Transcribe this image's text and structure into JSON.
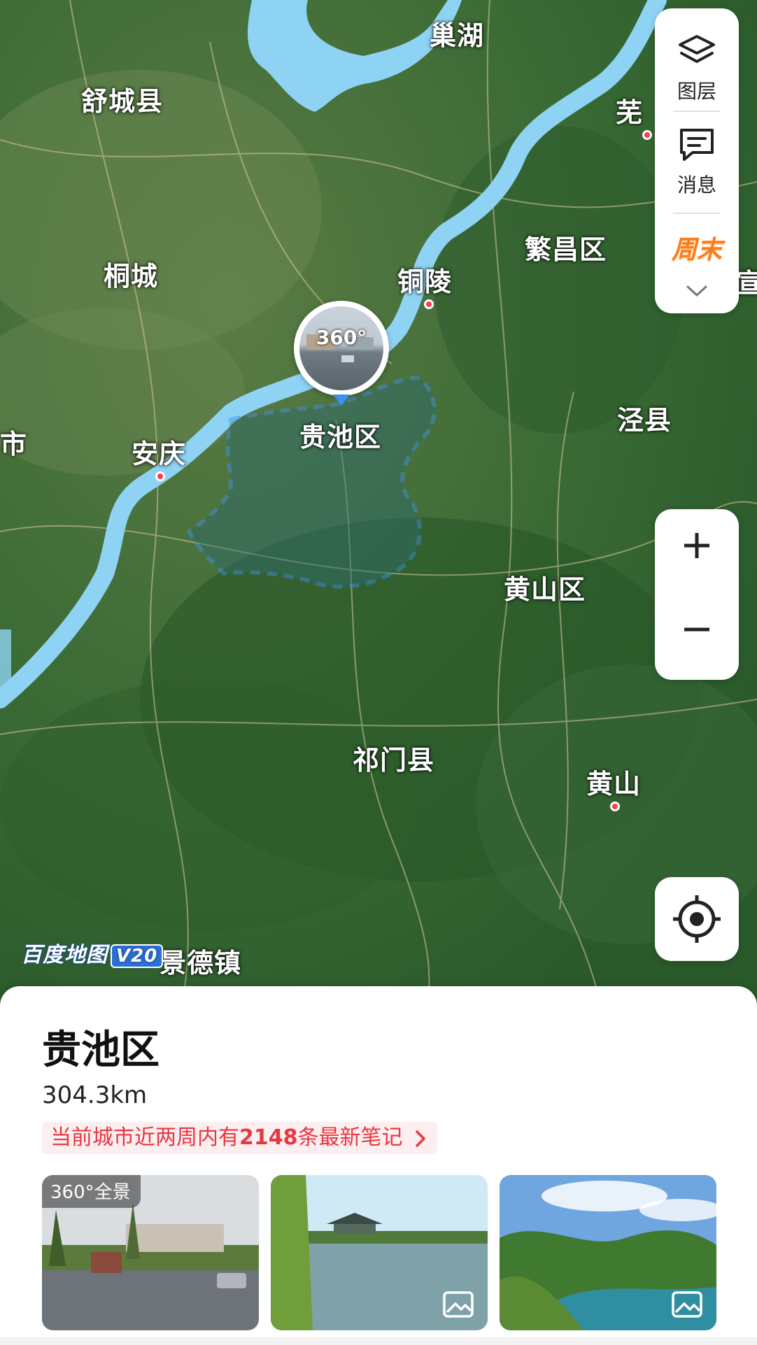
{
  "map": {
    "labels": {
      "chaohu": "巢湖",
      "shucheng": "舒城县",
      "wuhu": "芜",
      "fanchang": "繁昌区",
      "tongcheng": "桐城",
      "tongling": "铜陵",
      "xuan": "宣",
      "shi": "市",
      "anqing": "安庆",
      "guichi": "贵池区",
      "jingxian": "泾县",
      "huangshanqu": "黄山区",
      "qimen": "祁门县",
      "huangshan": "黄山",
      "jingdezhen": "景德镇"
    },
    "panorama_marker": {
      "label": "360°"
    },
    "brand": {
      "name": "百度地图",
      "version": "V20"
    },
    "colors": {
      "highlight": "#3d8ff0",
      "water": "#8fd3f4",
      "city_dot": "#ff3b4e"
    }
  },
  "side_panel": {
    "layers_label": "图层",
    "layers_icon": "layers-icon",
    "messages_label": "消息",
    "messages_icon": "message-icon",
    "weekend_badge": "周末",
    "expand_icon": "chevron-down-icon"
  },
  "zoom": {
    "in_icon": "plus-icon",
    "out_icon": "minus-icon"
  },
  "locate": {
    "icon": "locate-icon"
  },
  "sheet": {
    "title": "贵池区",
    "distance": "304.3km",
    "notes": {
      "prefix": "当前城市近两周内有",
      "count": "2148",
      "suffix": "条最新笔记"
    },
    "photos": [
      {
        "badge": "全景",
        "badge_prefix": "360°",
        "kind": "panorama"
      },
      {
        "kind": "image",
        "icon": "image-icon"
      },
      {
        "kind": "image",
        "icon": "image-icon"
      }
    ]
  }
}
